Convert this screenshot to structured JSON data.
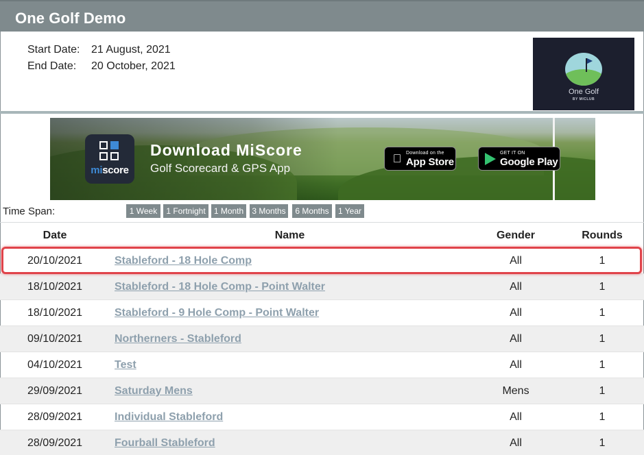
{
  "header": {
    "title": "One Golf Demo"
  },
  "info": {
    "start_label": "Start Date:",
    "start_value": "21 August, 2021",
    "end_label": "End Date:",
    "end_value": "20 October, 2021"
  },
  "logo": {
    "name": "One Golf",
    "sub": "BY MICLUB"
  },
  "banner": {
    "app_icon_text_a": "mi",
    "app_icon_text_b": "score",
    "title": "Download MiScore",
    "subtitle": "Golf Scorecard & GPS App",
    "app_store_small": "Download on the",
    "app_store_big": "App Store",
    "google_play_small": "GET IT ON",
    "google_play_big": "Google Play"
  },
  "timespan": {
    "label": "Time Span:",
    "options": [
      "1 Week",
      "1 Fortnight",
      "1 Month",
      "3 Months",
      "6 Months",
      "1 Year"
    ]
  },
  "table": {
    "columns": [
      "Date",
      "Name",
      "Gender",
      "Rounds"
    ],
    "rows": [
      {
        "date": "20/10/2021",
        "name": "Stableford - 18 Hole Comp",
        "gender": "All",
        "rounds": "1"
      },
      {
        "date": "18/10/2021",
        "name": "Stableford - 18 Hole Comp - Point Walter",
        "gender": "All",
        "rounds": "1"
      },
      {
        "date": "18/10/2021",
        "name": "Stableford - 9 Hole Comp - Point Walter",
        "gender": "All",
        "rounds": "1"
      },
      {
        "date": "09/10/2021",
        "name": "Northerners - Stableford",
        "gender": "All",
        "rounds": "1"
      },
      {
        "date": "04/10/2021",
        "name": "Test",
        "gender": "All",
        "rounds": "1"
      },
      {
        "date": "29/09/2021",
        "name": "Saturday Mens",
        "gender": "Mens",
        "rounds": "1"
      },
      {
        "date": "28/09/2021",
        "name": "Individual Stableford",
        "gender": "All",
        "rounds": "1"
      },
      {
        "date": "28/09/2021",
        "name": "Fourball Stableford",
        "gender": "All",
        "rounds": "1"
      }
    ]
  },
  "colors": {
    "title_bar": "#7f8a8d",
    "link": "#8ea0ad",
    "highlight": "#e0434a"
  }
}
